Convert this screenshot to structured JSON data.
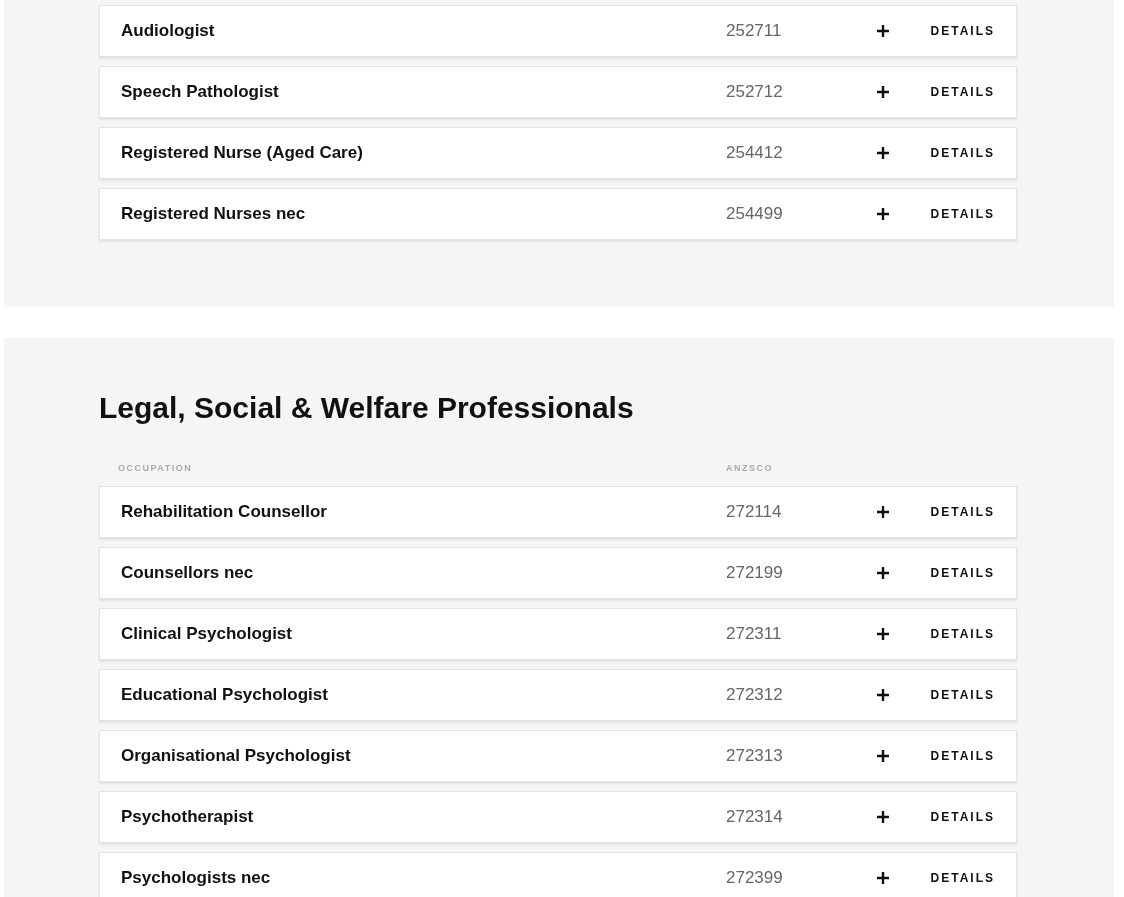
{
  "sections": [
    {
      "rows": [
        {
          "occupation": "Audiologist",
          "anzsco": "252711",
          "action": "DETAILS"
        },
        {
          "occupation": "Speech Pathologist",
          "anzsco": "252712",
          "action": "DETAILS"
        },
        {
          "occupation": "Registered Nurse (Aged Care)",
          "anzsco": "254412",
          "action": "DETAILS"
        },
        {
          "occupation": "Registered Nurses nec",
          "anzsco": "254499",
          "action": "DETAILS"
        }
      ]
    },
    {
      "title": "Legal, Social & Welfare Professionals",
      "columns": [
        "OCCUPATION",
        "ANZSCO"
      ],
      "rows": [
        {
          "occupation": "Rehabilitation Counsellor",
          "anzsco": "272114",
          "action": "DETAILS"
        },
        {
          "occupation": "Counsellors nec",
          "anzsco": "272199",
          "action": "DETAILS"
        },
        {
          "occupation": "Clinical Psychologist",
          "anzsco": "272311",
          "action": "DETAILS"
        },
        {
          "occupation": "Educational Psychologist",
          "anzsco": "272312",
          "action": "DETAILS"
        },
        {
          "occupation": "Organisational Psychologist",
          "anzsco": "272313",
          "action": "DETAILS"
        },
        {
          "occupation": "Psychotherapist",
          "anzsco": "272314",
          "action": "DETAILS"
        },
        {
          "occupation": "Psychologists nec",
          "anzsco": "272399",
          "action": "DETAILS"
        }
      ]
    }
  ]
}
